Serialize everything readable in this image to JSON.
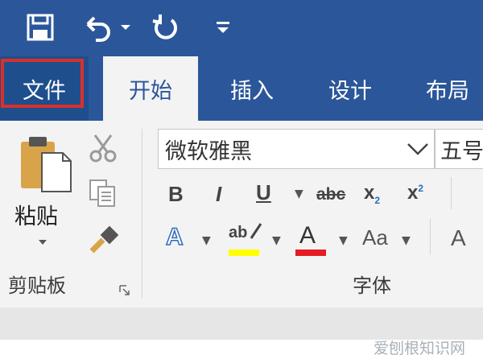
{
  "quick_access": {
    "icons": [
      "save-icon",
      "undo-icon",
      "dropdown-caret-icon",
      "redo-icon",
      "customize-qat-icon"
    ]
  },
  "tabs": [
    {
      "label": "文件",
      "active": false,
      "highlighted": true
    },
    {
      "label": "开始",
      "active": true
    },
    {
      "label": "插入",
      "active": false
    },
    {
      "label": "设计",
      "active": false
    },
    {
      "label": "布局",
      "active": false
    }
  ],
  "clipboard": {
    "paste_label": "粘贴",
    "group_label": "剪贴板",
    "icons": [
      "clipboard-paste-icon",
      "cut-icon",
      "copy-icon",
      "format-painter-icon",
      "dialog-launcher-icon"
    ]
  },
  "font": {
    "font_name": "微软雅黑",
    "font_size": "五号",
    "group_label": "字体",
    "bold": "B",
    "italic": "I",
    "underline": "U",
    "strikethrough": "abc",
    "subscript": "x",
    "subscript_mark": "2",
    "superscript": "x",
    "superscript_mark": "2",
    "text_effects": "A",
    "highlight": "ab",
    "font_color": "A",
    "change_case": "Aa",
    "grow_font": "A"
  },
  "colors": {
    "title_bar": "#2b579a",
    "file_tab": "#1e4e8c",
    "file_highlight_border": "#d9302b",
    "highlight_color": "#ffff00",
    "font_color_bar": "#e51c23",
    "ribbon_bg": "#f3f3f3"
  },
  "watermark": "爱刨根知识网"
}
